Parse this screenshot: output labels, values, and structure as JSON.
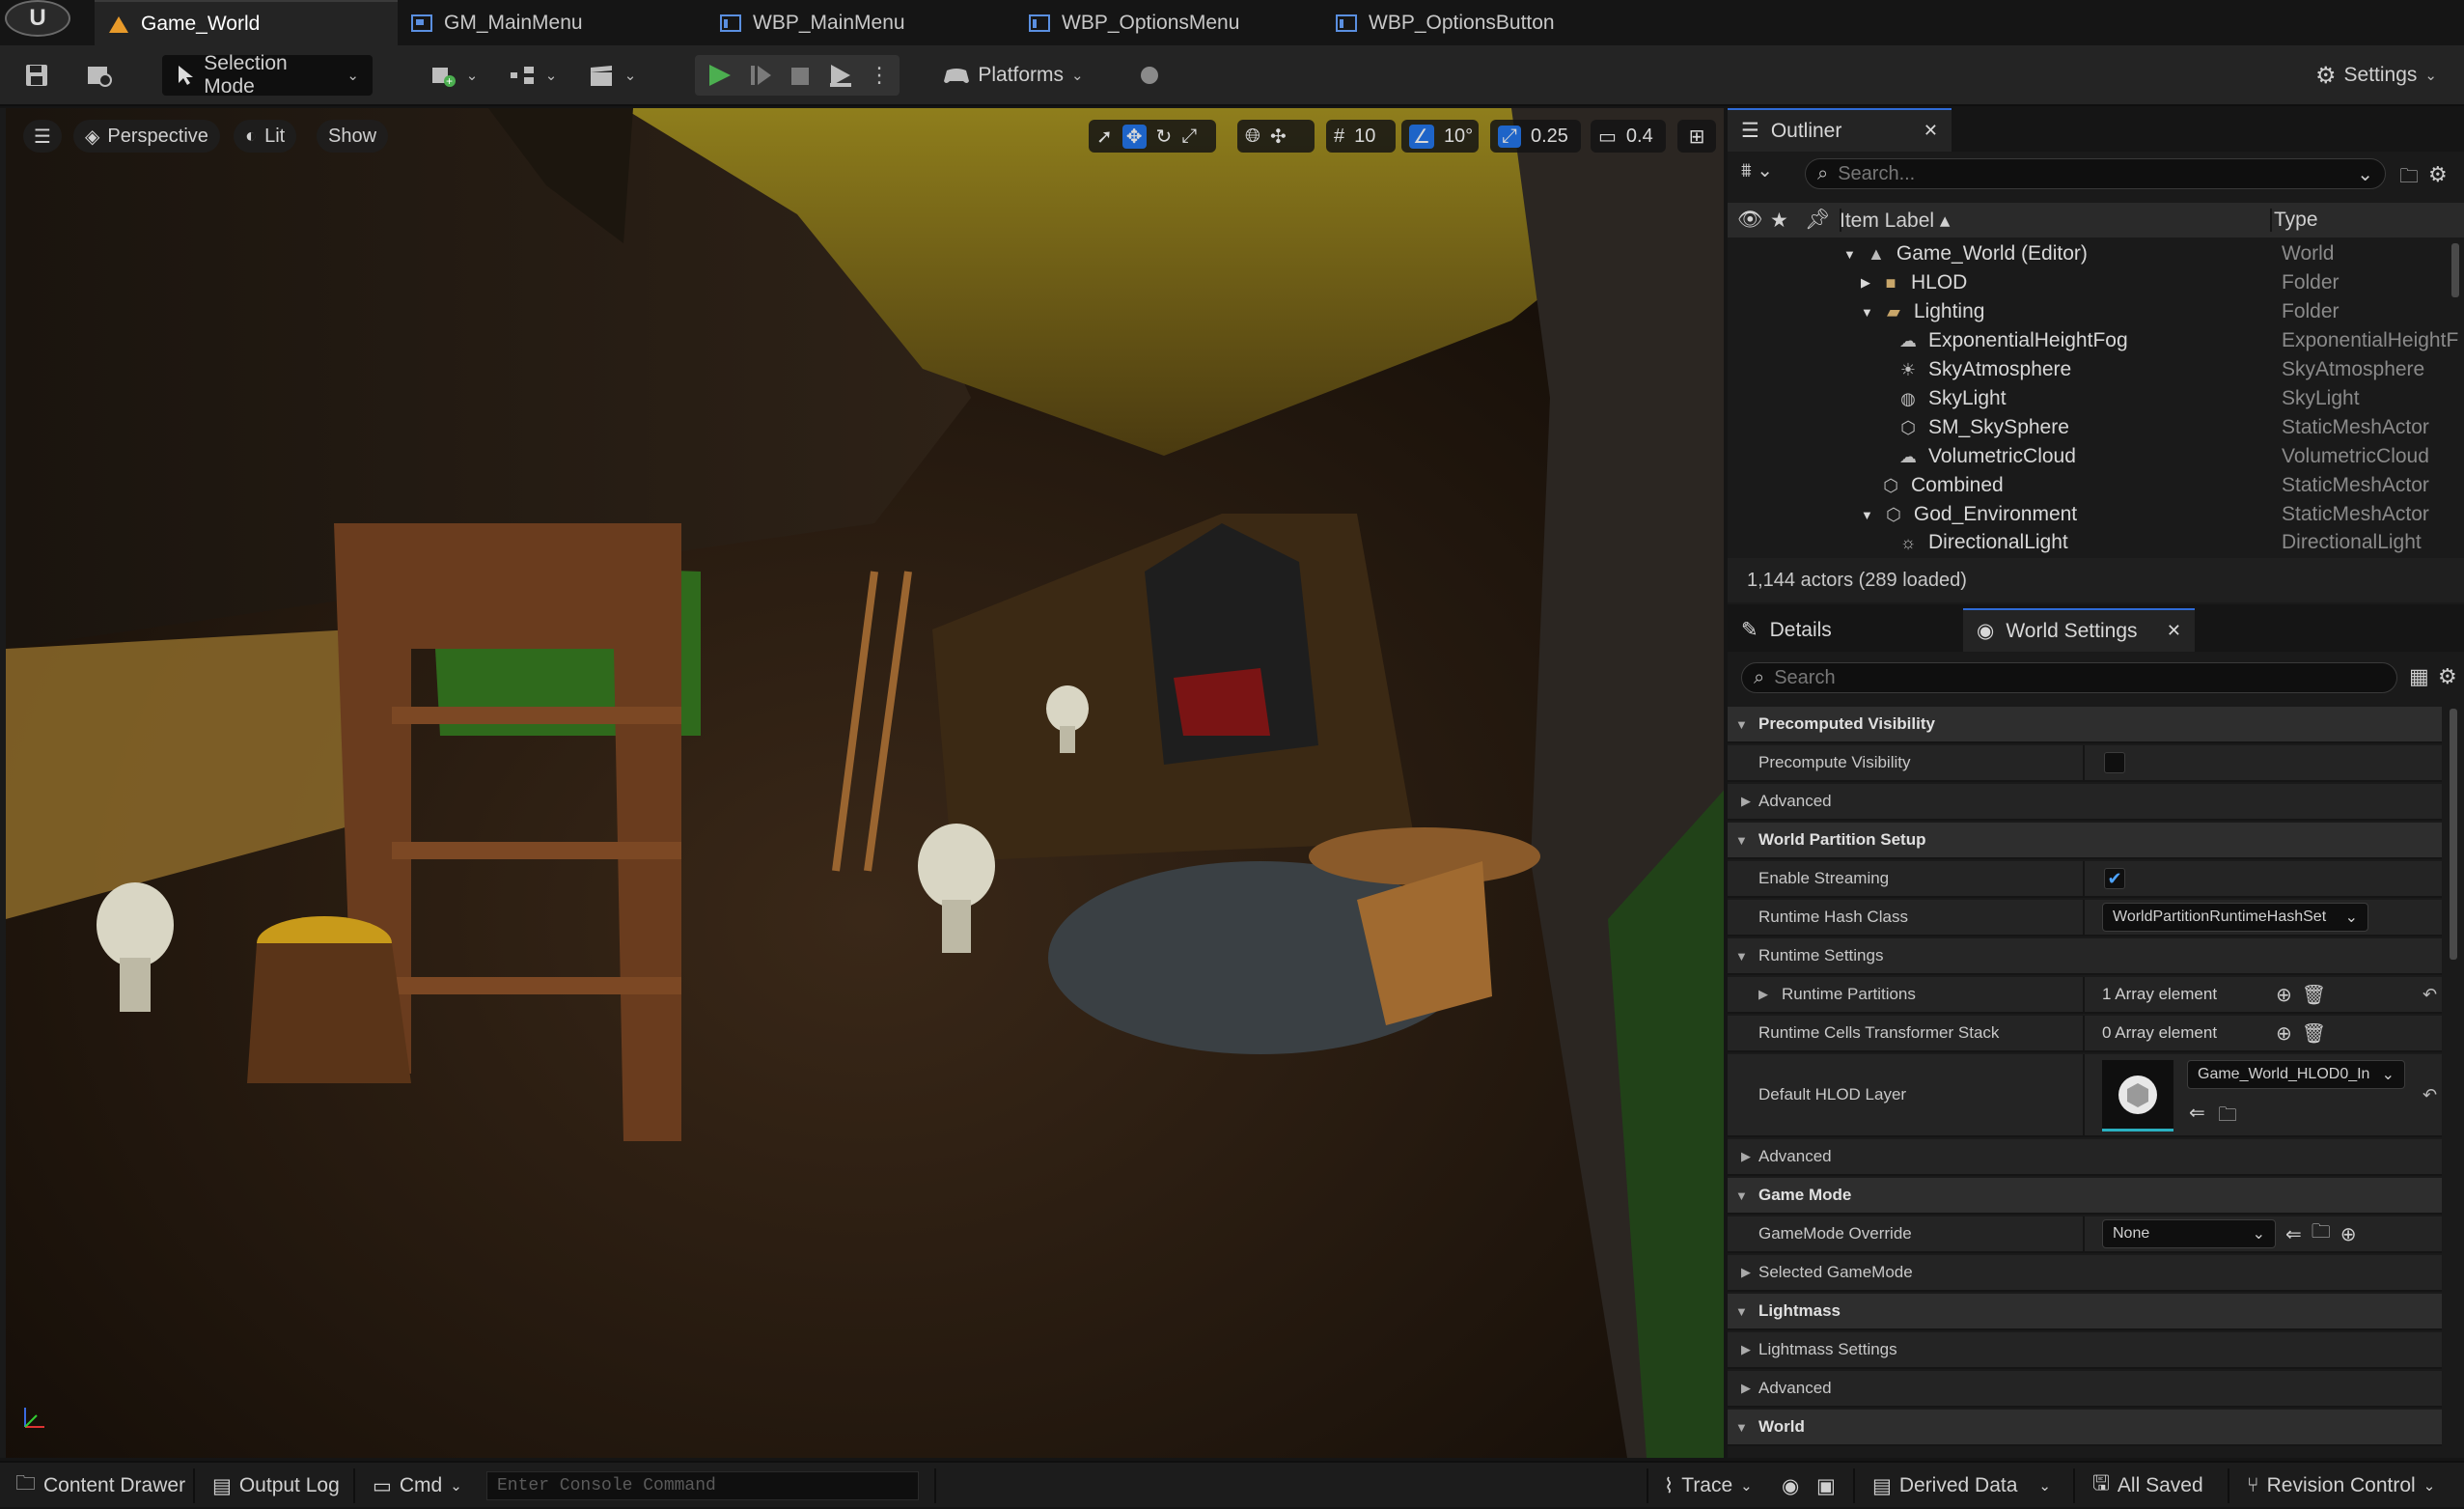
{
  "tabs": [
    {
      "label": "Game_World"
    },
    {
      "label": "GM_MainMenu"
    },
    {
      "label": "WBP_MainMenu"
    },
    {
      "label": "WBP_OptionsMenu"
    },
    {
      "label": "WBP_OptionsButton"
    }
  ],
  "toolbar": {
    "selection_mode": "Selection Mode",
    "platforms": "Platforms",
    "settings": "Settings"
  },
  "viewport": {
    "perspective": "Perspective",
    "lit": "Lit",
    "show": "Show",
    "grid_snap": "10",
    "rotation_snap": "10°",
    "scale_snap": "0.25",
    "camera_speed": "0.4"
  },
  "outliner": {
    "title": "Outliner",
    "search_placeholder": "Search...",
    "col_label": "Item Label",
    "col_type": "Type",
    "rows": [
      {
        "label": "Game_World (Editor)",
        "type": "World"
      },
      {
        "label": "HLOD",
        "type": "Folder"
      },
      {
        "label": "Lighting",
        "type": "Folder"
      },
      {
        "label": "ExponentialHeightFog",
        "type": "ExponentialHeightF"
      },
      {
        "label": "SkyAtmosphere",
        "type": "SkyAtmosphere"
      },
      {
        "label": "SkyLight",
        "type": "SkyLight"
      },
      {
        "label": "SM_SkySphere",
        "type": "StaticMeshActor"
      },
      {
        "label": "VolumetricCloud",
        "type": "VolumetricCloud"
      },
      {
        "label": "Combined",
        "type": "StaticMeshActor"
      },
      {
        "label": "God_Environment",
        "type": "StaticMeshActor"
      },
      {
        "label": "DirectionalLight",
        "type": "DirectionalLight"
      }
    ],
    "footer": "1,144 actors (289 loaded)"
  },
  "details": {
    "tab_details": "Details",
    "tab_world_settings": "World Settings",
    "search_placeholder": "Search",
    "rows": [
      {
        "kind": "cat",
        "label": "Precomputed Visibility"
      },
      {
        "kind": "prop",
        "label": "Precompute Visibility"
      },
      {
        "kind": "sub",
        "label": "Advanced"
      },
      {
        "kind": "cat",
        "label": "World Partition Setup"
      },
      {
        "kind": "prop",
        "label": "Enable Streaming"
      },
      {
        "kind": "prop",
        "label": "Runtime Hash Class",
        "value": "WorldPartitionRuntimeHashSet"
      },
      {
        "kind": "subcat",
        "label": "Runtime Settings"
      },
      {
        "kind": "prop",
        "label": "Runtime Partitions",
        "value": "1 Array element"
      },
      {
        "kind": "prop",
        "label": "Runtime Cells Transformer Stack",
        "value": "0 Array element"
      },
      {
        "kind": "prop",
        "label": "Default HLOD Layer",
        "value": "Game_World_HLOD0_In"
      },
      {
        "kind": "sub",
        "label": "Advanced"
      },
      {
        "kind": "cat",
        "label": "Game Mode"
      },
      {
        "kind": "prop",
        "label": "GameMode Override",
        "value": "None"
      },
      {
        "kind": "sub",
        "label": "Selected GameMode"
      },
      {
        "kind": "cat",
        "label": "Lightmass"
      },
      {
        "kind": "sub",
        "label": "Lightmass Settings"
      },
      {
        "kind": "sub",
        "label": "Advanced"
      },
      {
        "kind": "cat",
        "label": "World"
      }
    ]
  },
  "statusbar": {
    "content_drawer": "Content Drawer",
    "output_log": "Output Log",
    "cmd": "Cmd",
    "console_placeholder": "Enter Console Command",
    "trace": "Trace",
    "derived_data": "Derived Data",
    "all_saved": "All Saved",
    "revision_control": "Revision Control"
  },
  "colors": {
    "accent": "#2f6bd6",
    "play_green": "#4caf50"
  }
}
